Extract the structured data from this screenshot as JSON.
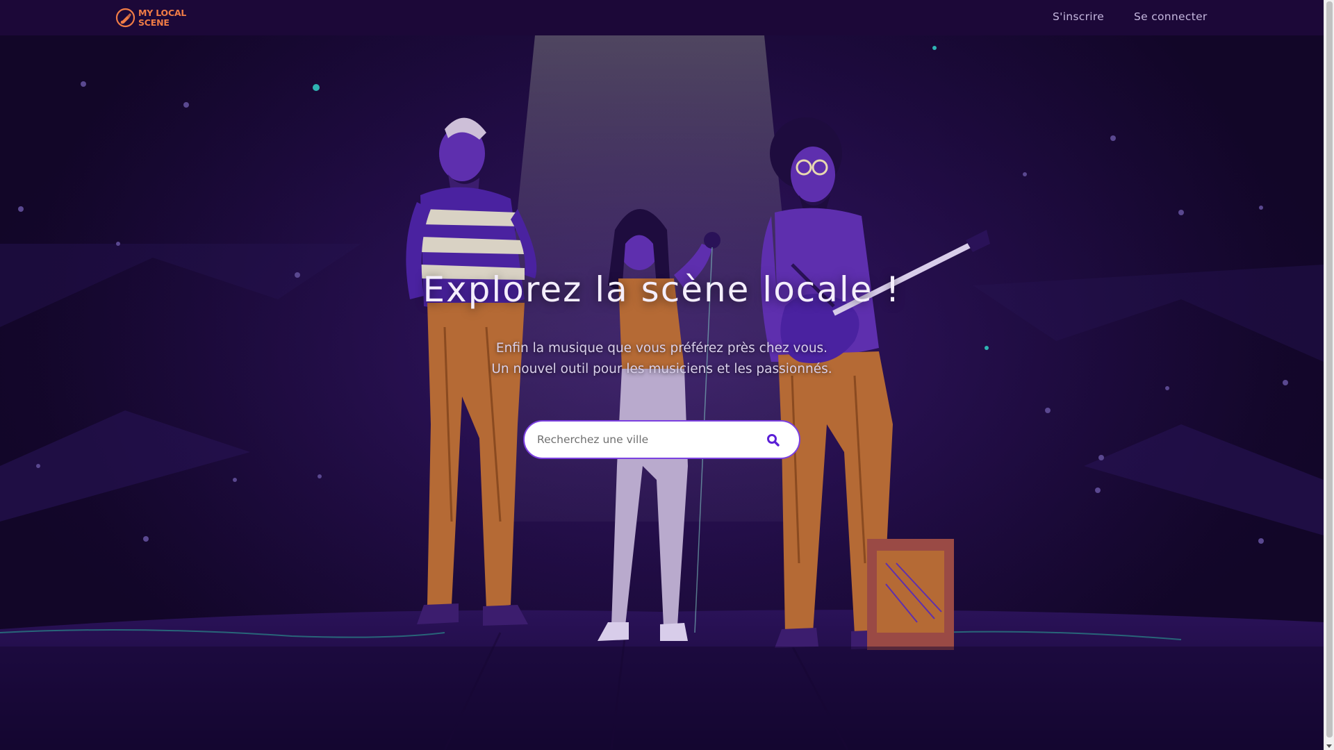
{
  "brand": {
    "line1": "MY LOCAL",
    "line2": "SCENE",
    "icon": "guitar-pick-logo-icon",
    "color": "#f07c46"
  },
  "nav": {
    "signup_label": "S'inscrire",
    "login_label": "Se connecter"
  },
  "hero": {
    "title": "Explorez la scène locale !",
    "subtitle_line1": "Enfin la musique que vous préférez près chez vous.",
    "subtitle_line2": "Un nouvel outil pour les musiciens et les passionnés."
  },
  "search": {
    "placeholder": "Recherchez une ville",
    "value": "",
    "icon": "search-icon",
    "accent": "#5b1fd6"
  },
  "colors": {
    "navbar_bg": "#1c0838",
    "hero_bg": "#1c0a3c",
    "pants": "#b56a35",
    "accent_purple": "#5b1fd6"
  }
}
